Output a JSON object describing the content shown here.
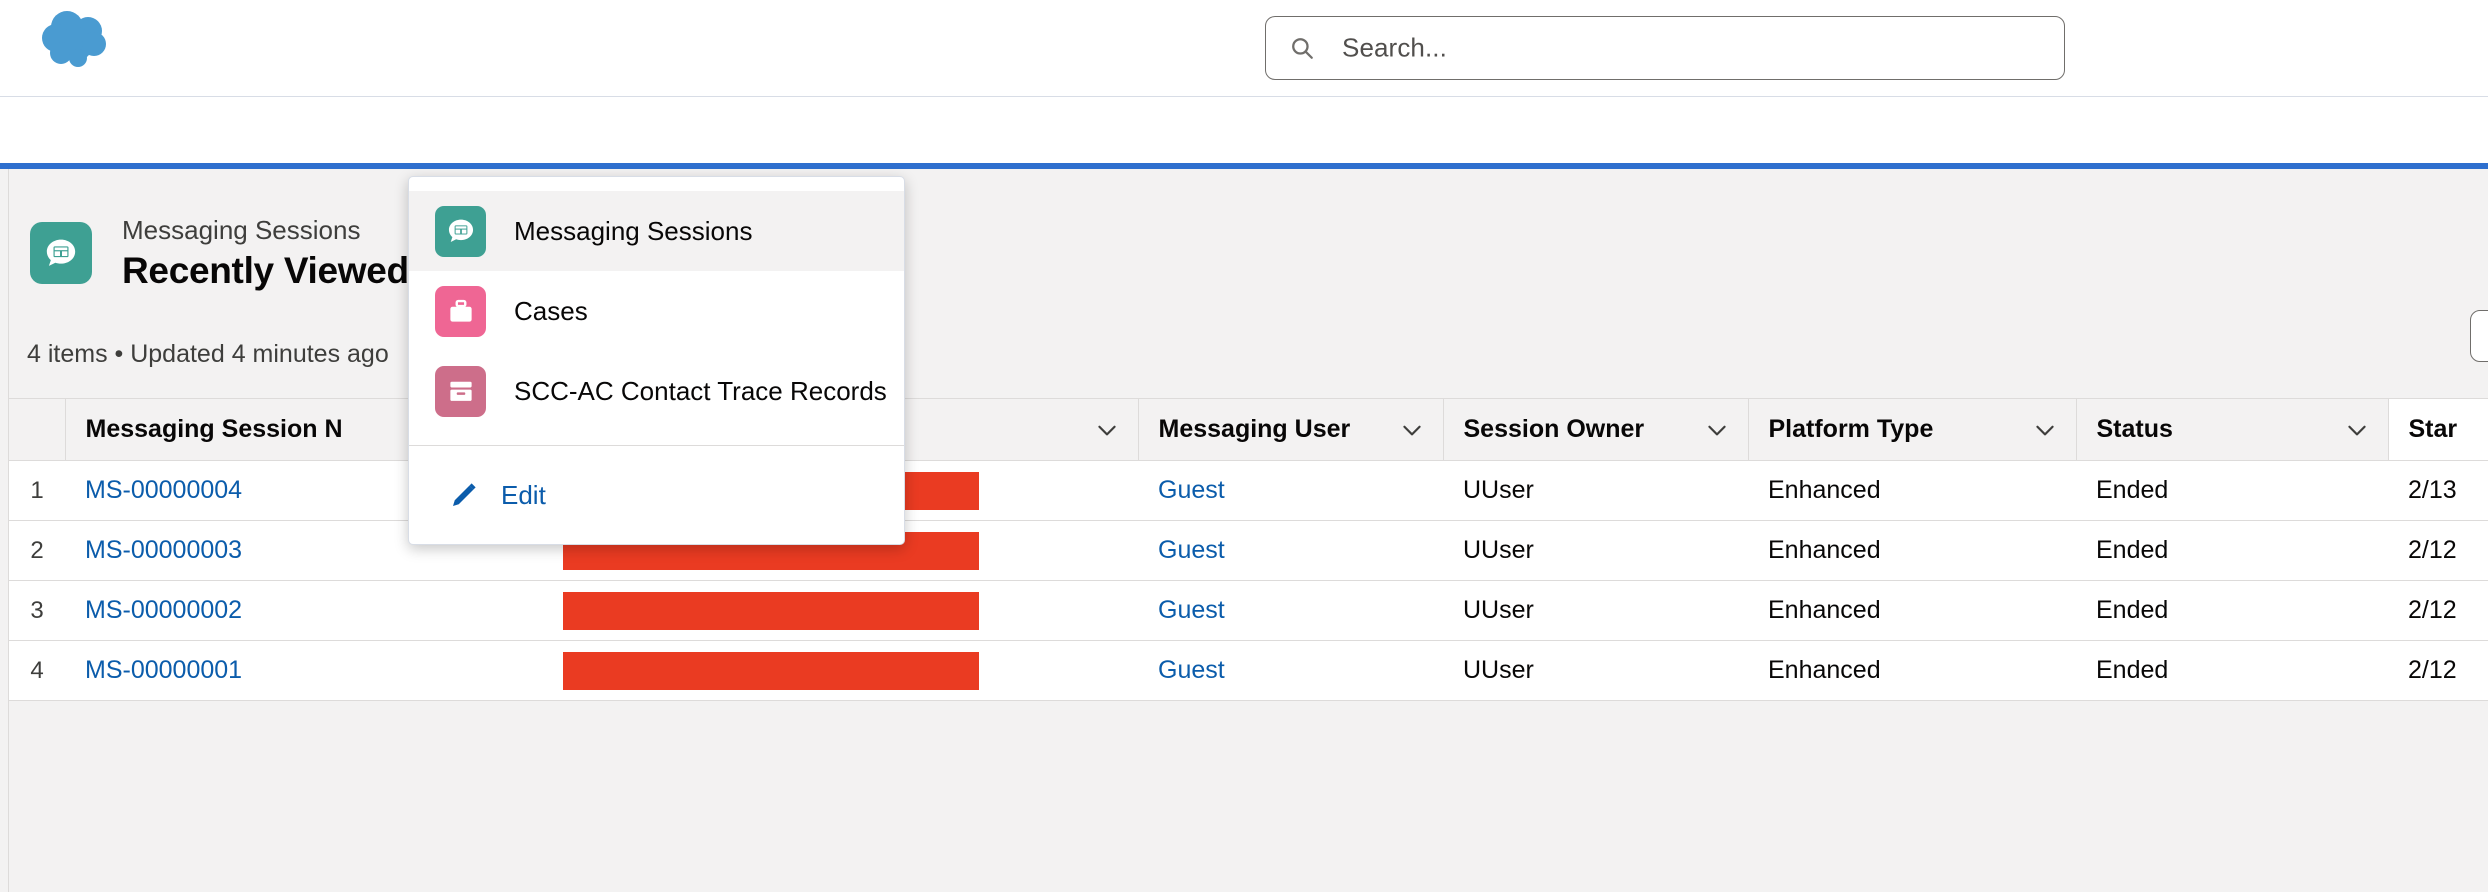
{
  "brand": {
    "logo_icon": "salesforce-cloud-logo",
    "logo_color": "#4a9bd1"
  },
  "global_header": {
    "search": {
      "icon": "search-icon",
      "placeholder": "Search...",
      "value": ""
    }
  },
  "nav": {
    "app_launcher_icon": "app-launcher-waffle-icon",
    "app_name_redacted": true,
    "redaction_color": "#ea3b22",
    "active_tab": {
      "label": "Messaging Sessions",
      "accent_color": "#2e6fce",
      "background": "#eef4fb"
    },
    "tab_dropdown_icon": "chevron-down-icon"
  },
  "dropdown_menu": {
    "items": [
      {
        "label": "Messaging Sessions",
        "icon": "messaging-session-icon",
        "icon_color": "#3ea093",
        "selected": true
      },
      {
        "label": "Cases",
        "icon": "case-briefcase-icon",
        "icon_color": "#ef6694",
        "selected": false
      },
      {
        "label": "SCC-AC Contact Trace Records",
        "icon": "contact-trace-record-icon",
        "icon_color": "#cd6e8a",
        "selected": false
      }
    ],
    "edit": {
      "label": "Edit",
      "icon": "pencil-edit-icon",
      "color": "#0b5cab"
    }
  },
  "list_header": {
    "object_icon": "messaging-session-icon",
    "object_icon_color": "#3ea093",
    "subtitle": "Messaging Sessions",
    "title": "Recently Viewed",
    "meta": "4 items • Updated 4 minutes ago",
    "search_list_input": {
      "icon": "search-icon",
      "placeholder": "",
      "value": ""
    }
  },
  "table": {
    "row_number_header": "",
    "columns": [
      {
        "label": "Messaging Session N",
        "sort_icon": "chevron-down-icon"
      },
      {
        "label": "",
        "sort_icon": "chevron-down-icon"
      },
      {
        "label": "Messaging User",
        "sort_icon": "chevron-down-icon"
      },
      {
        "label": "Session Owner",
        "sort_icon": "chevron-down-icon"
      },
      {
        "label": "Platform Type",
        "sort_icon": "chevron-down-icon"
      },
      {
        "label": "Status",
        "sort_icon": "chevron-down-icon"
      },
      {
        "label": "Star",
        "sort_icon": "chevron-down-icon"
      }
    ],
    "rows": [
      {
        "num": "1",
        "session_name": "MS-00000004",
        "redacted": true,
        "messaging_user": "Guest",
        "session_owner": "UUser",
        "platform_type": "Enhanced",
        "status": "Ended",
        "start_time": "2/13"
      },
      {
        "num": "2",
        "session_name": "MS-00000003",
        "redacted": true,
        "messaging_user": "Guest",
        "session_owner": "UUser",
        "platform_type": "Enhanced",
        "status": "Ended",
        "start_time": "2/12"
      },
      {
        "num": "3",
        "session_name": "MS-00000002",
        "redacted": true,
        "messaging_user": "Guest",
        "session_owner": "UUser",
        "platform_type": "Enhanced",
        "status": "Ended",
        "start_time": "2/12"
      },
      {
        "num": "4",
        "session_name": "MS-00000001",
        "redacted": true,
        "messaging_user": "Guest",
        "session_owner": "UUser",
        "platform_type": "Enhanced",
        "status": "Ended",
        "start_time": "2/12"
      }
    ]
  },
  "colors": {
    "link": "#0b5cab",
    "accent_blue": "#2e6fce",
    "redaction_red": "#ea3b22",
    "page_bg": "#f3f2f2",
    "border": "#dddbda"
  }
}
